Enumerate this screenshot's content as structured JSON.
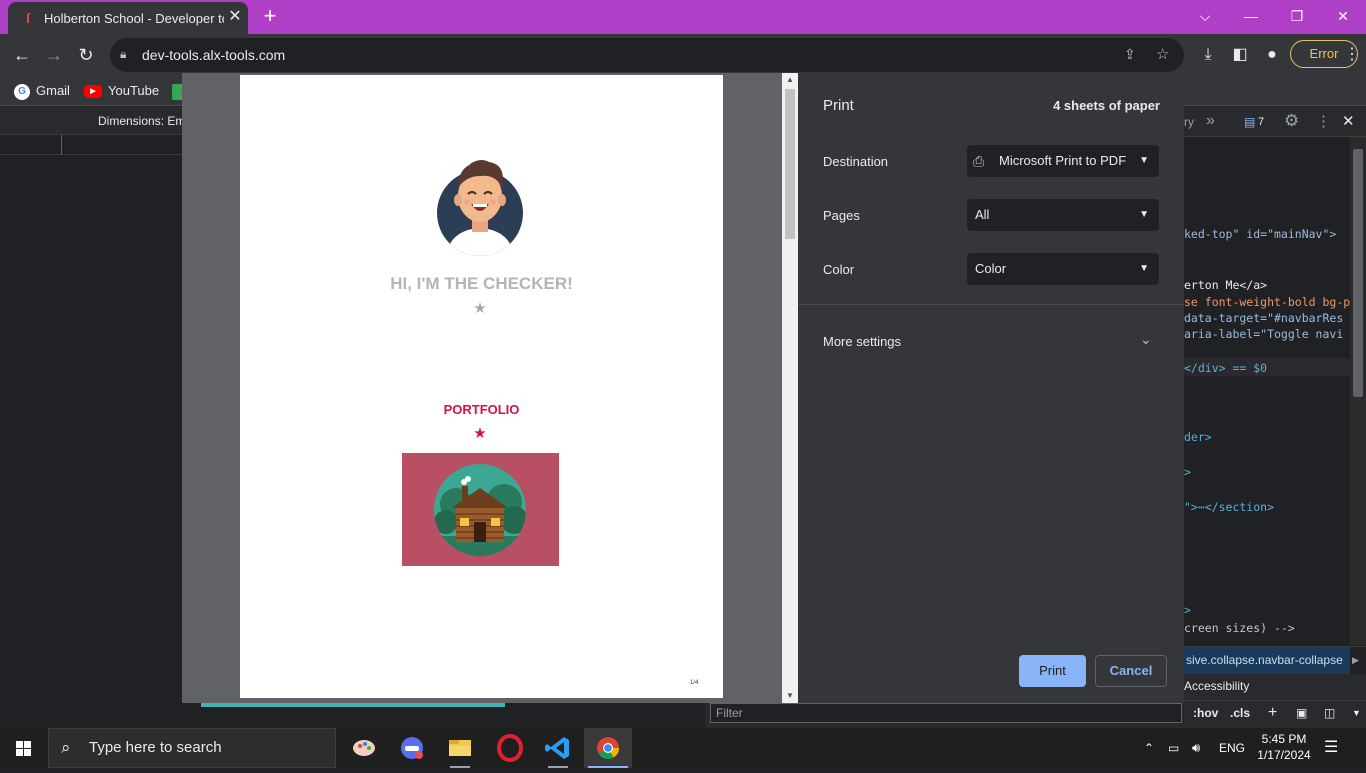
{
  "browser": {
    "tab_title": "Holberton School - Developer to",
    "new_tab": "+",
    "url": "dev-tools.alx-tools.com",
    "error_label": "Error"
  },
  "bookmarks": [
    {
      "label": "Gmail",
      "icon": "google-icon"
    },
    {
      "label": "YouTube",
      "icon": "youtube-icon"
    }
  ],
  "devtools": {
    "dimensions_label": "Dimensions: Em",
    "tab_more": "ry",
    "issues_count": "7",
    "code_lines": [
      {
        "text": "ked-top\" id=\"mainNav\">"
      },
      {
        "text": "erton Me</a>"
      },
      {
        "text": "se font-weight-bold bg-p"
      },
      {
        "text": "  data-target=\"#navbarRes"
      },
      {
        "text": "  aria-label=\"Toggle navi"
      },
      {
        "text": "</div> == $0"
      },
      {
        "text": "der>"
      },
      {
        "text": ">"
      },
      {
        "text": "\">⋯</section>"
      },
      {
        "text": ">"
      },
      {
        "text": "creen sizes) -->"
      }
    ],
    "breadcrumb": "sive.collapse.navbar-collapse",
    "accessibility_tab": "Accessibility",
    "filter_placeholder": "Filter",
    "hov": ":hov",
    "cls": ".cls"
  },
  "print_dialog": {
    "title": "Print",
    "sheets": "4 sheets of paper",
    "destination_label": "Destination",
    "destination_value": "Microsoft Print to PDF",
    "pages_label": "Pages",
    "pages_value": "All",
    "color_label": "Color",
    "color_value": "Color",
    "more_settings": "More settings",
    "print_button": "Print",
    "cancel_button": "Cancel"
  },
  "preview_page": {
    "checker_heading": "HI, I'M THE CHECKER!",
    "portfolio_heading": "PORTFOLIO",
    "page_number": "1/4"
  },
  "taskbar": {
    "search_placeholder": "Type here to search",
    "language": "ENG",
    "time": "5:45 PM",
    "date": "1/17/2024"
  },
  "colors": {
    "tabstrip": "#b03fc7",
    "accent": "#8ab4f8",
    "portfolio_red": "#d40f4b",
    "portfolio_card": "#b94f63"
  }
}
